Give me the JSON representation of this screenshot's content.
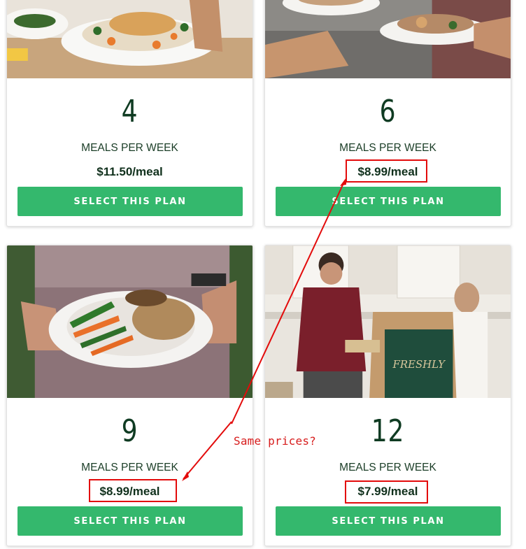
{
  "plans": [
    {
      "meals": "4",
      "label": "MEALS PER WEEK",
      "price": "$11.50/meal",
      "button": "SELECT THIS PLAN"
    },
    {
      "meals": "6",
      "label": "MEALS PER WEEK",
      "price": "$8.99/meal",
      "button": "SELECT THIS PLAN"
    },
    {
      "meals": "9",
      "label": "MEALS PER WEEK",
      "price": "$8.99/meal",
      "button": "SELECT THIS PLAN"
    },
    {
      "meals": "12",
      "label": "MEALS PER WEEK",
      "price": "$7.99/meal",
      "button": "SELECT THIS PLAN"
    }
  ],
  "annotation": {
    "note": "Same prices?",
    "color": "#e30b0b"
  },
  "colors": {
    "button": "#34b86d",
    "meal_count": "#0f3b22"
  },
  "images": {
    "box_brand_text": "FRESHLY"
  }
}
